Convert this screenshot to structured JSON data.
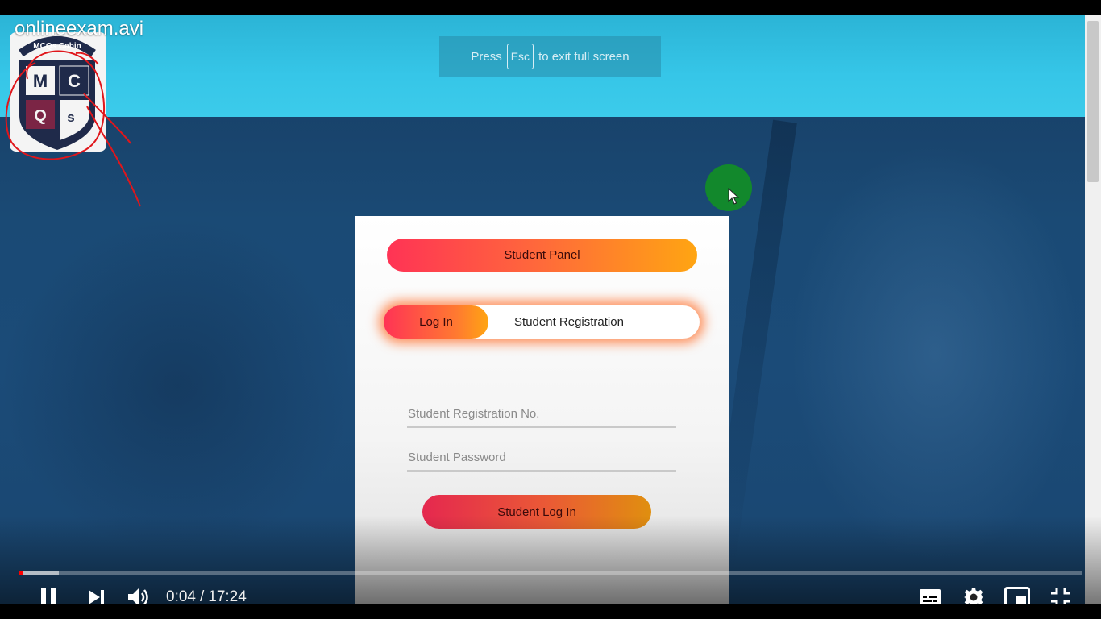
{
  "player": {
    "title": "onlineexam.avi",
    "fullscreen_notice": {
      "before": "Press",
      "key": "Esc",
      "after": "to exit full screen"
    },
    "time": {
      "current": "0:04",
      "separator": "/",
      "duration": "17:24"
    },
    "progress": {
      "played_fraction": 0.0035,
      "buffered_fraction": 0.037
    },
    "controls": [
      "pause-icon",
      "next-icon",
      "volume-icon",
      "subtitles-icon",
      "settings-icon",
      "miniplayer-icon",
      "exit-fullscreen-icon"
    ]
  },
  "logo": {
    "arc_text": "MCQs Cabin",
    "letters": [
      "M",
      "C",
      "Q",
      "s"
    ],
    "colors": {
      "navy": "#1f2a4a",
      "maroon": "#7b2545",
      "annotation": "#e0161b"
    }
  },
  "panel": {
    "header": "Student Panel",
    "tabs": {
      "login": "Log In",
      "register": "Student Registration"
    },
    "fields": {
      "registration_placeholder": "Student Registration No.",
      "password_placeholder": "Student Password"
    },
    "submit": "Student Log In"
  },
  "colors": {
    "header_bg": "#36c6e8",
    "page_bg": "#1a4a75",
    "gradient_start": "#ff3355",
    "gradient_end": "#ffa512",
    "click_indicator": "#12882c",
    "progress_played": "#ff0000"
  }
}
